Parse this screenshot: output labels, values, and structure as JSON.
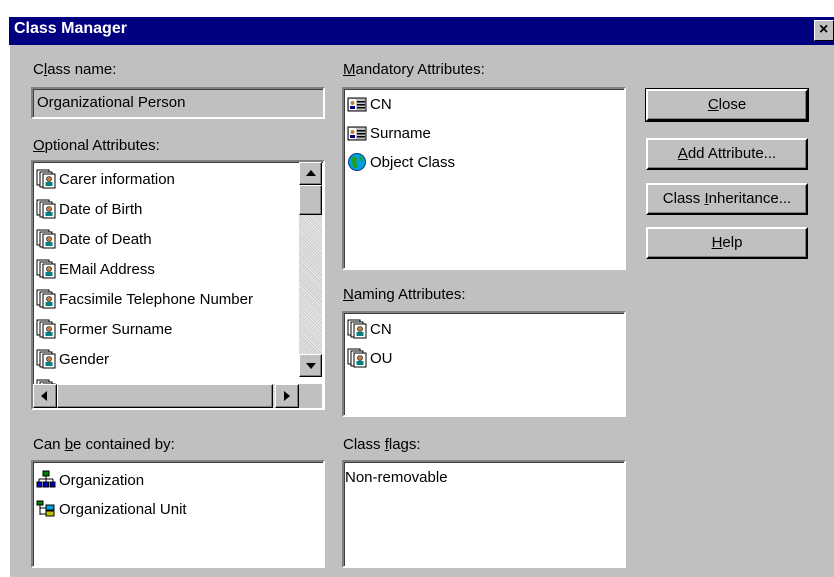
{
  "window": {
    "title": "Class Manager",
    "close_glyph": "×"
  },
  "class_name": {
    "label_pre": "C",
    "label_acc": "l",
    "label_post": "ass name:",
    "value": "Organizational Person"
  },
  "optional": {
    "label_acc": "O",
    "label_post": "ptional Attributes:",
    "items": [
      "Carer information",
      "Date of Birth",
      "Date of Death",
      "EMail Address",
      "Facsimile Telephone Number",
      "Former Surname",
      "Gender",
      "I"
    ]
  },
  "mandatory": {
    "label_acc": "M",
    "label_post": "andatory Attributes:",
    "items": [
      {
        "label": "CN",
        "icon": "attribute-card-icon"
      },
      {
        "label": "Surname",
        "icon": "attribute-card-icon"
      },
      {
        "label": "Object Class",
        "icon": "globe-icon"
      }
    ]
  },
  "naming": {
    "label_acc": "N",
    "label_post": "aming Attributes:",
    "items": [
      "CN",
      "OU"
    ]
  },
  "contained_by": {
    "label_pre": "Can ",
    "label_acc": "b",
    "label_post": "e contained by:",
    "items": [
      {
        "label": "Organization",
        "icon": "organization-icon"
      },
      {
        "label": "Organizational Unit",
        "icon": "org-unit-icon"
      }
    ]
  },
  "class_flags": {
    "label_pre": "Class ",
    "label_acc": "f",
    "label_post": "lags:",
    "value": "Non-removable"
  },
  "buttons": {
    "close": {
      "acc": "C",
      "post": "lose"
    },
    "add_attribute": {
      "acc": "A",
      "post": "dd Attribute..."
    },
    "class_inheritance": {
      "pre": "Class ",
      "acc": "I",
      "post": "nheritance..."
    },
    "help": {
      "acc": "H",
      "post": "elp"
    }
  }
}
